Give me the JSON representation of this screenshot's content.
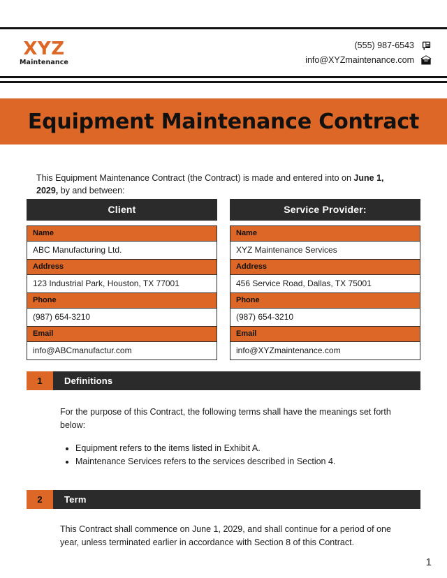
{
  "header": {
    "logo_main": "XYZ",
    "logo_sub": "Maintenance",
    "phone": "(555) 987-6543",
    "email": "info@XYZmaintenance.com",
    "phone_icon": "desk-phone-icon",
    "email_icon": "envelope-icon"
  },
  "title": "Equipment Maintenance Contract",
  "intro": {
    "part1": "This Equipment Maintenance Contract (the Contract) is made and entered into on ",
    "date": "June 1, 2029,",
    "part2": " by and between:"
  },
  "parties": [
    {
      "heading": "Client",
      "rows": [
        {
          "label": "Name",
          "value": "ABC Manufacturing Ltd."
        },
        {
          "label": "Address",
          "value": "123 Industrial Park, Houston, TX 77001"
        },
        {
          "label": "Phone",
          "value": "(987) 654-3210"
        },
        {
          "label": "Email",
          "value": "info@ABCmanufactur.com"
        }
      ]
    },
    {
      "heading": "Service Provider:",
      "rows": [
        {
          "label": "Name",
          "value": "XYZ Maintenance Services"
        },
        {
          "label": "Address",
          "value": "456 Service Road, Dallas, TX 75001"
        },
        {
          "label": "Phone",
          "value": "(987) 654-3210"
        },
        {
          "label": "Email",
          "value": "info@XYZmaintenance.com"
        }
      ]
    }
  ],
  "sections": [
    {
      "number": "1",
      "title": "Definitions",
      "body": "For the purpose of this Contract, the following terms shall have the meanings set forth below:",
      "bullets": [
        "Equipment refers to the items listed in Exhibit A.",
        "Maintenance Services refers to the services described in Section 4."
      ]
    },
    {
      "number": "2",
      "title": "Term",
      "body": "This Contract shall commence on June 1, 2029, and shall continue for a period of one year, unless terminated earlier in accordance with Section 8 of this Contract.",
      "bullets": []
    }
  ],
  "page_number": "1",
  "colors": {
    "accent_orange": "#DD6727",
    "dark_bar": "#2B2B2B",
    "rule": "#111111"
  }
}
